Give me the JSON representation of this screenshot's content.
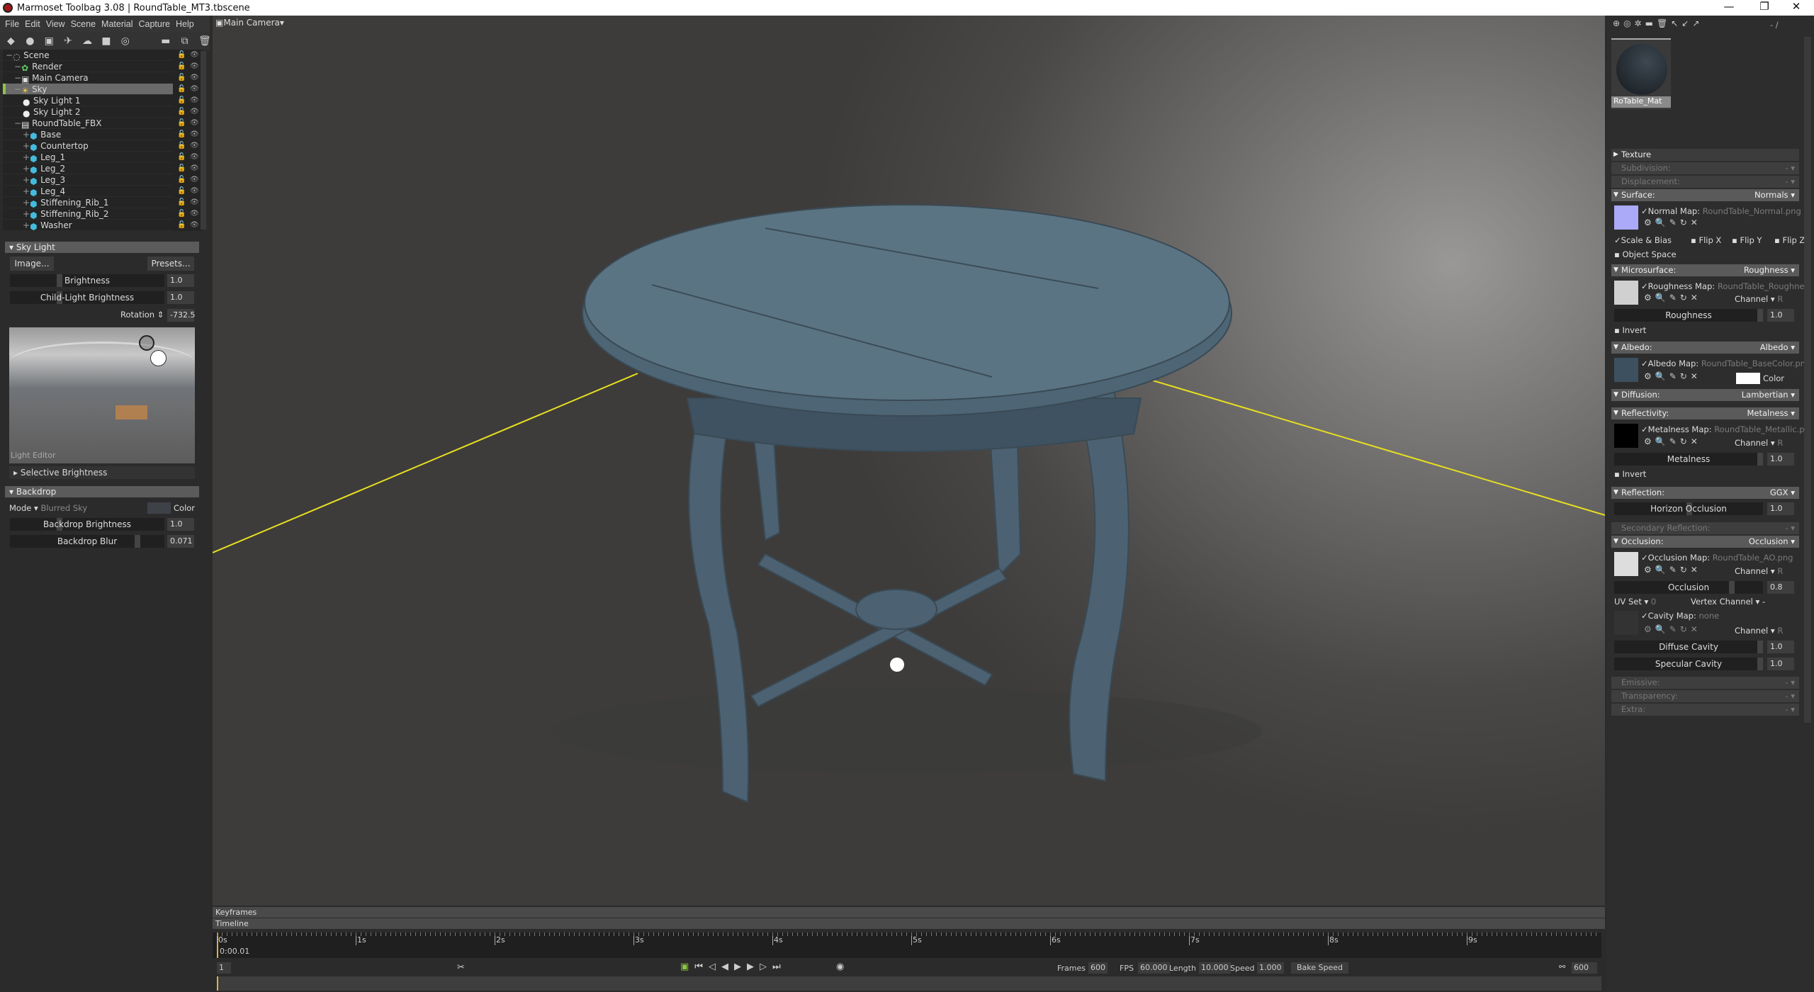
{
  "window": {
    "title": "Marmoset Toolbag 3.08  |  RoundTable_MT3.tbscene",
    "minimize": "—",
    "maximize": "❐",
    "close": "✕"
  },
  "menu": [
    "File",
    "Edit",
    "View",
    "Scene",
    "Material",
    "Capture",
    "Help"
  ],
  "viewport": {
    "camera": "Main Camera"
  },
  "outliner": [
    {
      "label": "Scene",
      "indent": 0,
      "icon": "scene-icon"
    },
    {
      "label": "Render",
      "indent": 1,
      "icon": "render-gear-icon"
    },
    {
      "label": "Main Camera",
      "indent": 1,
      "icon": "camera-icon"
    },
    {
      "label": "Sky",
      "indent": 1,
      "icon": "sky-icon",
      "selected": true
    },
    {
      "label": "Sky Light 1",
      "indent": 2,
      "icon": "light-bulb-icon"
    },
    {
      "label": "Sky Light 2",
      "indent": 2,
      "icon": "light-bulb-icon"
    },
    {
      "label": "RoundTable_FBX",
      "indent": 1,
      "icon": "fbx-icon"
    },
    {
      "label": "Base",
      "indent": 2,
      "icon": "mesh-icon"
    },
    {
      "label": "Countertop",
      "indent": 2,
      "icon": "mesh-icon"
    },
    {
      "label": "Leg_1",
      "indent": 2,
      "icon": "mesh-icon"
    },
    {
      "label": "Leg_2",
      "indent": 2,
      "icon": "mesh-icon"
    },
    {
      "label": "Leg_3",
      "indent": 2,
      "icon": "mesh-icon"
    },
    {
      "label": "Leg_4",
      "indent": 2,
      "icon": "mesh-icon"
    },
    {
      "label": "Stiffening_Rib_1",
      "indent": 2,
      "icon": "mesh-icon"
    },
    {
      "label": "Stiffening_Rib_2",
      "indent": 2,
      "icon": "mesh-icon"
    },
    {
      "label": "Washer",
      "indent": 2,
      "icon": "mesh-icon"
    }
  ],
  "skylight": {
    "title": "Sky Light",
    "image_btn": "Image...",
    "presets_btn": "Presets...",
    "brightness_label": "Brightness",
    "brightness": "1.0",
    "child_label": "Child-Light Brightness",
    "child": "1.0",
    "rotation_label": "Rotation",
    "rotation": "-732.5",
    "light_editor": "Light Editor",
    "selective": "Selective Brightness"
  },
  "backdrop": {
    "title": "Backdrop",
    "mode_label": "Mode",
    "mode": "Blurred Sky",
    "color_label": "Color",
    "brightness_label": "Backdrop Brightness",
    "brightness": "1.0",
    "blur_label": "Backdrop Blur",
    "blur": "0.071"
  },
  "materials": {
    "page": "- /",
    "selected": "RoTable_Mat"
  },
  "props": {
    "texture": "Texture",
    "subdivision": "Subdivision:",
    "displacement": "Displacement:",
    "dash": "-",
    "surface": "Surface:",
    "surface_mode": "Normals",
    "normal_map_label": "Normal Map:",
    "normal_map": "RoundTable_Normal.png",
    "scale_bias": "Scale & Bias",
    "flip_x": "Flip X",
    "flip_y": "Flip Y",
    "flip_z": "Flip Z",
    "object_space": "Object Space",
    "microsurface": "Microsurface:",
    "micro_mode": "Roughness",
    "rough_map_label": "Roughness Map:",
    "rough_map": "RoundTable_Roughnes",
    "channel": "Channel",
    "channel_val": "R",
    "roughness_label": "Roughness",
    "roughness": "1.0",
    "invert": "Invert",
    "albedo": "Albedo:",
    "albedo_mode": "Albedo",
    "albedo_map_label": "Albedo Map:",
    "albedo_map": "RoundTable_BaseColor.png",
    "color": "Color",
    "diffusion": "Diffusion:",
    "diffusion_mode": "Lambertian",
    "reflectivity": "Reflectivity:",
    "refl_mode": "Metalness",
    "metal_map_label": "Metalness Map:",
    "metal_map": "RoundTable_Metallic.pn",
    "metalness_label": "Metalness",
    "metalness": "1.0",
    "reflection": "Reflection:",
    "reflection_mode": "GGX",
    "horizon_label": "Horizon Occlusion",
    "horizon": "1.0",
    "secondary": "Secondary Reflection:",
    "occlusion": "Occlusion:",
    "occ_mode": "Occlusion",
    "occ_map_label": "Occlusion Map:",
    "occ_map": "RoundTable_AO.png",
    "occ_label": "Occlusion",
    "occ": "0.8",
    "uvset_label": "UV Set",
    "uvset": "0",
    "vertex_label": "Vertex Channel",
    "vertex": "-",
    "cavity_map_label": "Cavity Map:",
    "cavity_map": "none",
    "diffuse_cavity_label": "Diffuse Cavity",
    "diffuse_cavity": "1.0",
    "spec_cavity_label": "Specular Cavity",
    "spec_cavity": "1.0",
    "emissive": "Emissive:",
    "transparency": "Transparency:",
    "extra": "Extra:"
  },
  "timeline": {
    "keyframes": "Keyframes",
    "timeline": "Timeline",
    "ticks": [
      "0s",
      "1s",
      "2s",
      "3s",
      "4s",
      "5s",
      "6s",
      "7s",
      "8s",
      "9s"
    ],
    "current_time": "0:00.01",
    "frame": "1",
    "frames_label": "Frames",
    "frames": "600",
    "fps_label": "FPS",
    "fps": "60.000",
    "length_label": "Length",
    "length": "10.000",
    "speed_label": "Speed",
    "speed": "1.000",
    "bake_speed": "Bake Speed",
    "end_frame": "600"
  },
  "colors": {
    "accent_green": "#8cc63f",
    "light_path": "#e8e020"
  }
}
